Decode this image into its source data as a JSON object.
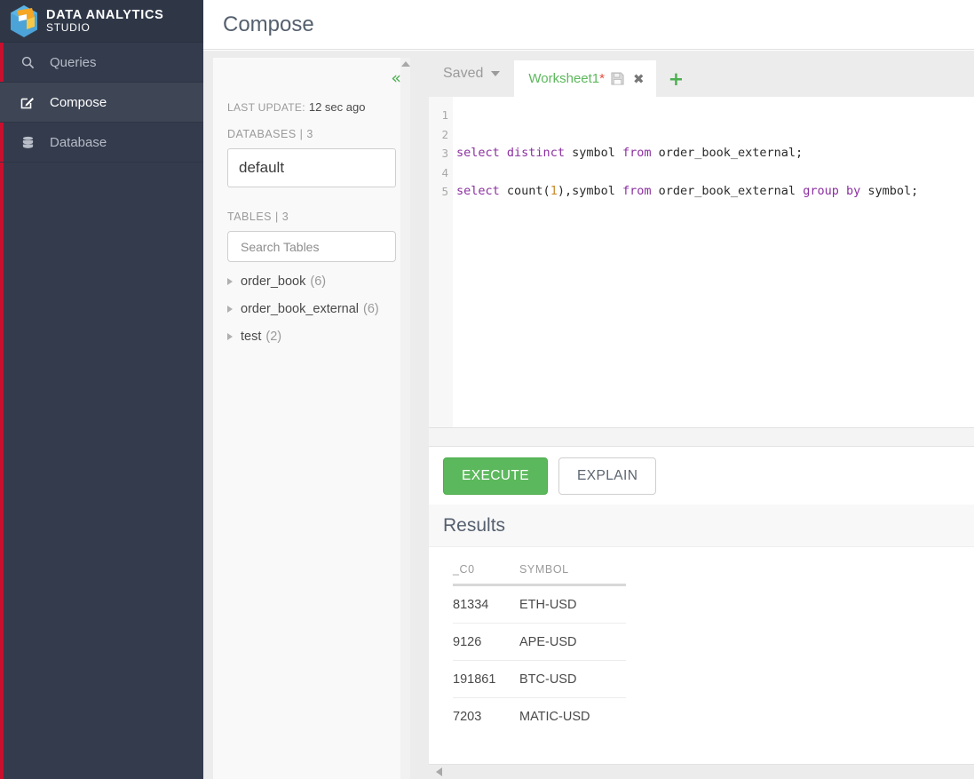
{
  "app": {
    "logo_line1": "DATA ANALYTICS",
    "logo_line2": "STUDIO",
    "logo_icon": "cube-logo-icon"
  },
  "sidebar": {
    "items": [
      {
        "label": "Queries",
        "icon": "search-icon",
        "active": false
      },
      {
        "label": "Compose",
        "icon": "compose-icon",
        "active": true
      },
      {
        "label": "Database",
        "icon": "database-icon",
        "active": false
      }
    ]
  },
  "header": {
    "title": "Compose"
  },
  "assist": {
    "collapse_icon": "double-chevron-left-icon",
    "last_update_label": "LAST UPDATE:",
    "last_update_value": "12 sec ago",
    "databases_label": "DATABASES",
    "databases_sep": "|",
    "databases_count": "3",
    "selected_database": "default",
    "tables_label": "TABLES",
    "tables_sep": "|",
    "tables_count": "3",
    "search_placeholder": "Search Tables",
    "search_value": "",
    "tables": [
      {
        "name": "order_book",
        "count": "(6)"
      },
      {
        "name": "order_book_external",
        "count": "(6)"
      },
      {
        "name": "test",
        "count": "(2)"
      }
    ]
  },
  "tabbar": {
    "saved_label": "Saved",
    "worksheet_name": "Worksheet1",
    "dirty_marker": "*",
    "save_icon": "floppy-save-icon",
    "close_icon": "close-x-icon",
    "add_icon": "plus-icon"
  },
  "editor": {
    "line_numbers": [
      "1",
      "2",
      "3",
      "4",
      "5"
    ],
    "lines": [
      [],
      [],
      [
        {
          "t": "select",
          "c": "kw"
        },
        {
          "t": " ",
          "c": "id"
        },
        {
          "t": "distinct",
          "c": "kw"
        },
        {
          "t": " symbol ",
          "c": "id"
        },
        {
          "t": "from",
          "c": "kw"
        },
        {
          "t": " order_book_external;",
          "c": "id"
        }
      ],
      [],
      [
        {
          "t": "select",
          "c": "kw"
        },
        {
          "t": " count(",
          "c": "id"
        },
        {
          "t": "1",
          "c": "num"
        },
        {
          "t": "),symbol ",
          "c": "id"
        },
        {
          "t": "from",
          "c": "kw"
        },
        {
          "t": " order_book_external ",
          "c": "id"
        },
        {
          "t": "group",
          "c": "kw"
        },
        {
          "t": " ",
          "c": "id"
        },
        {
          "t": "by",
          "c": "kw"
        },
        {
          "t": " symbol;",
          "c": "id"
        }
      ]
    ]
  },
  "actions": {
    "execute_label": "EXECUTE",
    "explain_label": "EXPLAIN"
  },
  "results": {
    "title": "Results",
    "columns": [
      "_C0",
      "SYMBOL"
    ],
    "rows": [
      [
        "81334",
        "ETH-USD"
      ],
      [
        "9126",
        "APE-USD"
      ],
      [
        "191861",
        "BTC-USD"
      ],
      [
        "7203",
        "MATIC-USD"
      ]
    ]
  },
  "colors": {
    "sidebar_bg": "#333b4c",
    "sidebar_active": "#3e4555",
    "accent_red": "#c8102e",
    "brand_green": "#5cb85c",
    "tab_green": "#5cb85c",
    "dirty_red": "#e74c3c",
    "sql_keyword": "#8b2fa0",
    "sql_number": "#c98a2e"
  }
}
